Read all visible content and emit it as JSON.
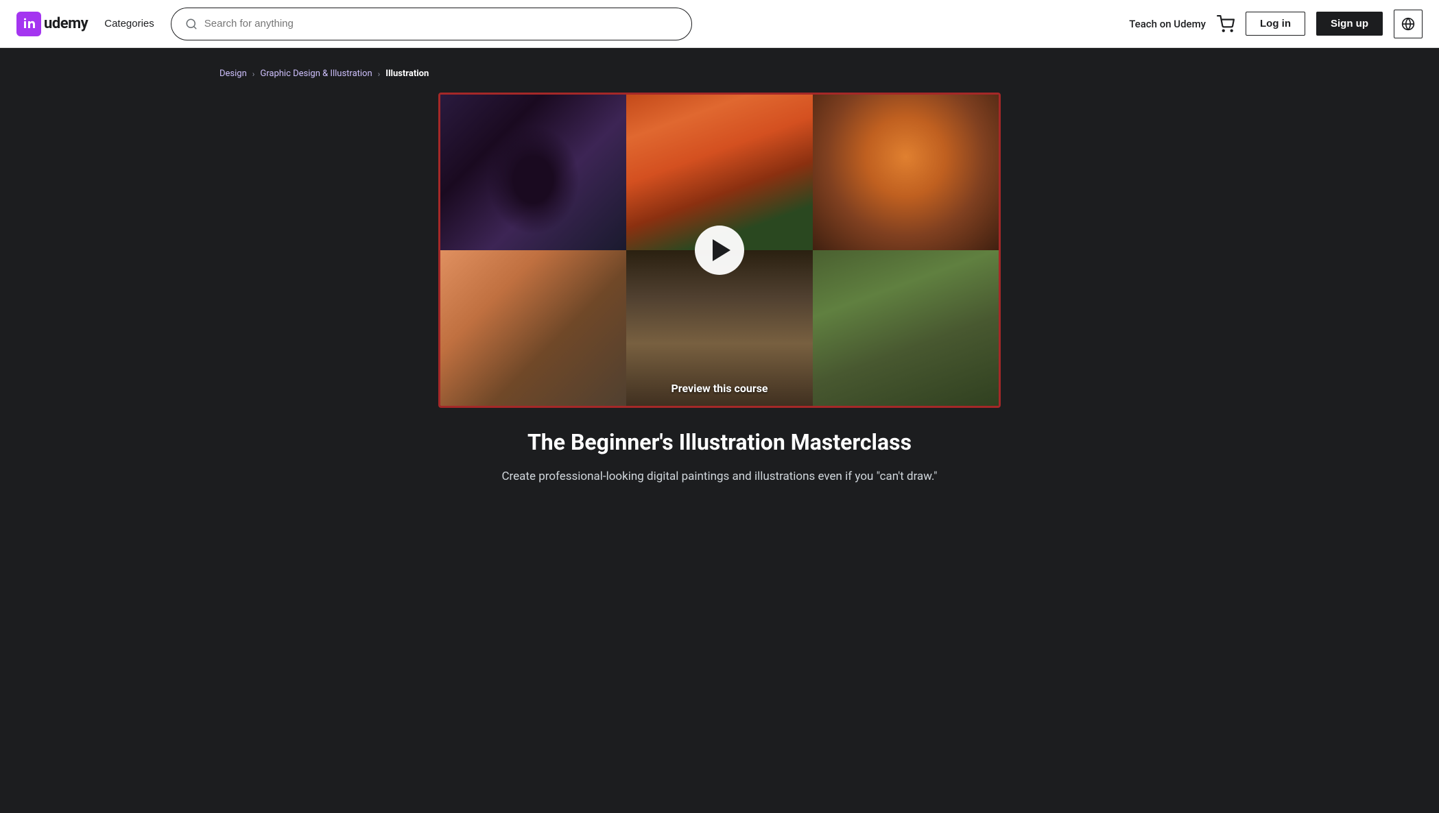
{
  "header": {
    "logo_text": "udemy",
    "categories_label": "Categories",
    "search_placeholder": "Search for anything",
    "teach_label": "Teach on Udemy",
    "login_label": "Log in",
    "signup_label": "Sign up"
  },
  "breadcrumb": {
    "items": [
      {
        "label": "Design",
        "active": false
      },
      {
        "label": "Graphic Design & Illustration",
        "active": false
      },
      {
        "label": "Illustration",
        "active": true
      }
    ]
  },
  "course": {
    "preview_label": "Preview this course",
    "title": "The Beginner's Illustration Masterclass",
    "subtitle": "Create professional-looking digital paintings and illustrations even if you \"can't draw.\""
  },
  "colors": {
    "accent_purple": "#cec0fc",
    "dark_bg": "#1c1d1f",
    "video_border": "#a52828"
  }
}
